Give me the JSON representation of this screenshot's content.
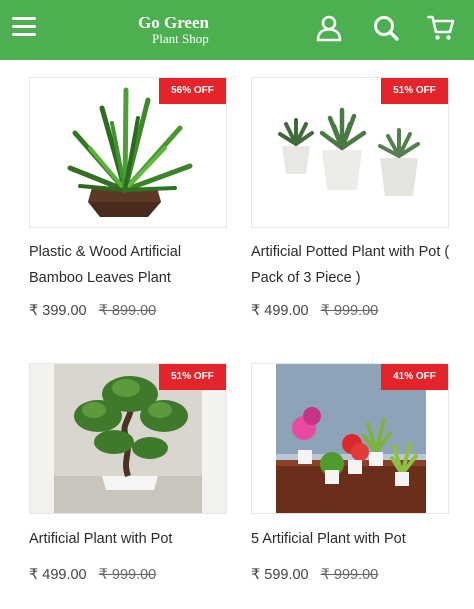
{
  "header": {
    "brand_title": "Go Green",
    "brand_subtitle": "Plant Shop",
    "bg_color": "#4caf50",
    "icons": [
      "menu-icon",
      "user-icon",
      "search-icon",
      "cart-icon"
    ]
  },
  "products": [
    {
      "discount": "56% OFF",
      "name": "Plastic & Wood Artificial Bamboo Leaves Plant",
      "price": "₹ 399.00",
      "original_price": "₹ 899.00"
    },
    {
      "discount": "51% OFF",
      "name": "Artificial Potted Plant with Pot ( Pack of 3 Piece )",
      "price": "₹ 499.00",
      "original_price": "₹ 999.00"
    },
    {
      "discount": "51% OFF",
      "name": "Artificial Plant with Pot",
      "price": "₹ 499.00",
      "original_price": "₹ 999.00"
    },
    {
      "discount": "41% OFF",
      "name": "5 Artificial Plant with Pot",
      "price": "₹ 599.00",
      "original_price": "₹ 999.00"
    }
  ],
  "badge_color": "#e4242b"
}
